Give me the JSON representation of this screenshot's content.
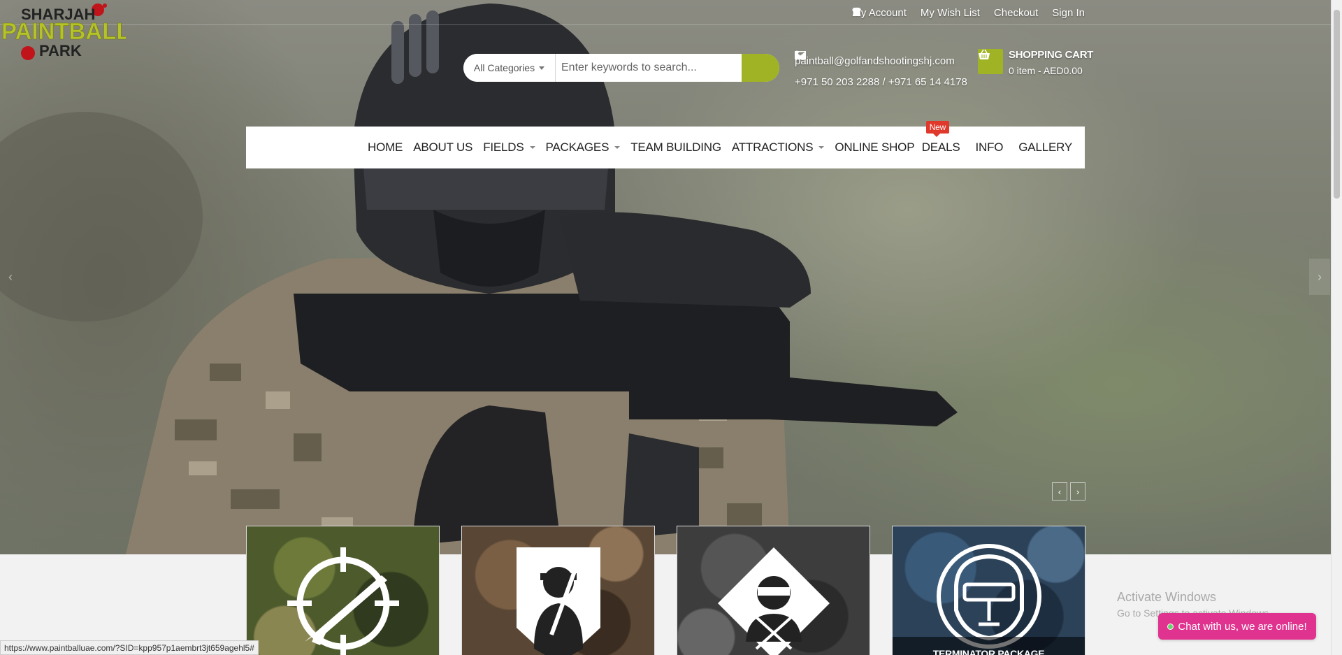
{
  "topbar": {
    "links": [
      {
        "label": "My Account",
        "icon": "user-icon"
      },
      {
        "label": "My Wish List",
        "icon": "heart-icon"
      },
      {
        "label": "Checkout",
        "icon": "checkout-icon"
      },
      {
        "label": "Sign In",
        "icon": "lock-icon"
      }
    ]
  },
  "logo": {
    "line1": "SHARJAH",
    "line2": "PAINTBALL",
    "line3": "PARK"
  },
  "search": {
    "category": "All Categories",
    "placeholder": "Enter keywords to search..."
  },
  "contact": {
    "email": "paintball@golfandshootingshj.com",
    "phone": "+971 50 203 2288 / +971 65 14 4178"
  },
  "cart": {
    "title": "SHOPPING CART",
    "summary": "0 item - AED0.00"
  },
  "nav": {
    "left": [
      {
        "label": "HOME"
      },
      {
        "label": "ABOUT US"
      },
      {
        "label": "FIELDS"
      },
      {
        "label": "PACKAGES"
      },
      {
        "label": "TEAM BUILDING"
      },
      {
        "label": "ATTRACTIONS"
      },
      {
        "label": "ONLINE SHOP"
      }
    ],
    "right": [
      {
        "label": "DEALS",
        "badge": "New"
      },
      {
        "label": "INFO"
      },
      {
        "label": "GALLERY"
      }
    ]
  },
  "slider": {
    "prev": "‹",
    "next": "›"
  },
  "tiles": [
    {
      "caption": ""
    },
    {
      "caption": ""
    },
    {
      "caption": ""
    },
    {
      "caption": "TERMINATOR  PACKAGE"
    }
  ],
  "status_url": "https://www.paintballuae.com/?SID=kpp957p1aembrt3jt659agehl5#",
  "watermark": {
    "title": "Activate Windows",
    "subtitle": "Go to Settings to activate Windows."
  },
  "chat": {
    "label": "Chat with us, we are online!"
  },
  "colors": {
    "accent": "#9fb324",
    "chat": "#e0338f",
    "badge": "#e0392b"
  }
}
